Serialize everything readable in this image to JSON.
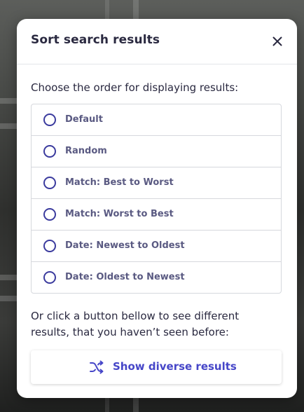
{
  "modal": {
    "title": "Sort search results",
    "prompt": "Choose the order for displaying results:",
    "options": [
      {
        "label": "Default"
      },
      {
        "label": "Random"
      },
      {
        "label": "Match: Best to Worst"
      },
      {
        "label": "Match: Worst to Best"
      },
      {
        "label": "Date: Newest to Oldest"
      },
      {
        "label": "Date: Oldest to Newest"
      }
    ],
    "info_line1": "Or click a button bellow to see different",
    "info_line2": "results, that you haven’t seen before:",
    "diverse_button": {
      "label": "Show diverse results",
      "icon": "shuffle-icon"
    },
    "close_icon": "close-icon"
  },
  "colors": {
    "title": "#2a2940",
    "radio": "#3b3b9e",
    "option_text": "#5a5a82",
    "accent": "#4646c8"
  }
}
